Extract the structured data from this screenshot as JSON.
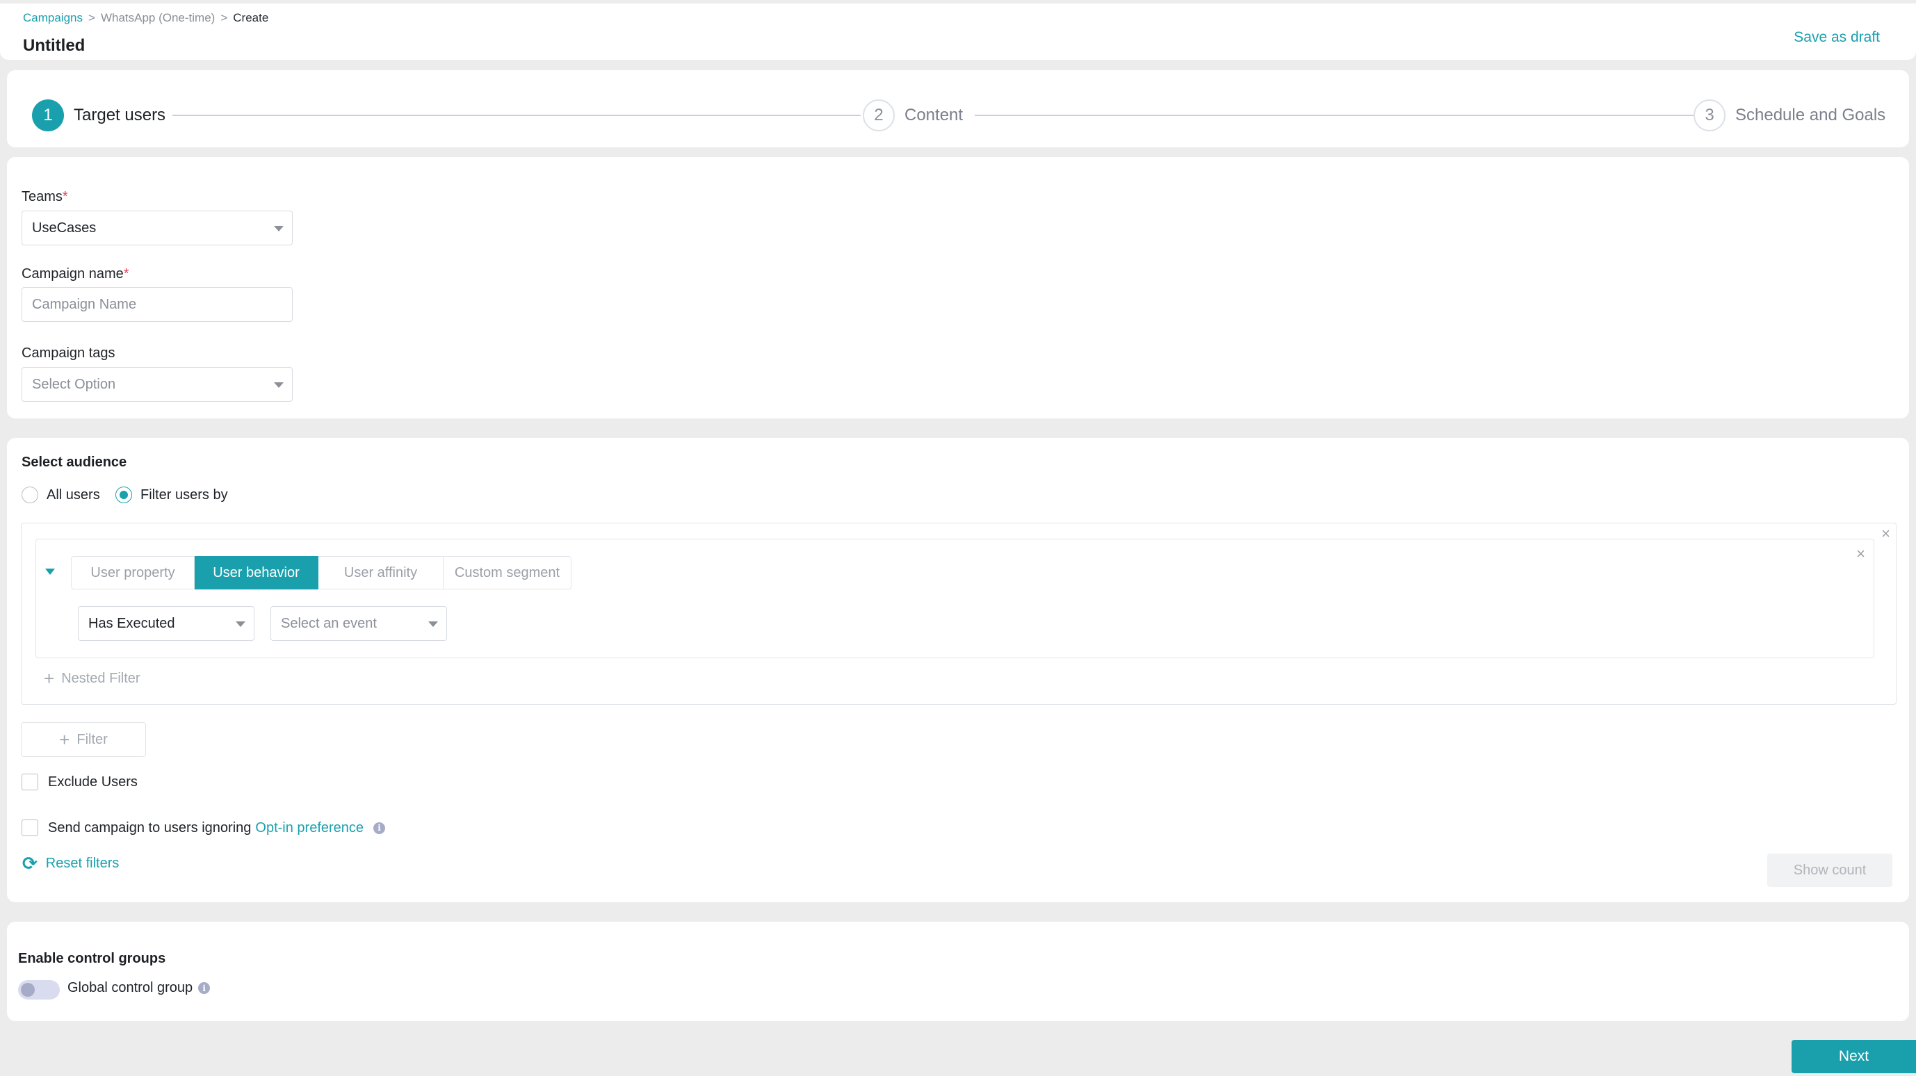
{
  "header": {
    "breadcrumb": {
      "root": "Campaigns",
      "middle": "WhatsApp (One-time)",
      "current": "Create",
      "separator": ">"
    },
    "title": "Untitled",
    "save_draft_label": "Save as draft"
  },
  "stepper": {
    "steps": [
      {
        "number": "1",
        "label": "Target users",
        "state": "active"
      },
      {
        "number": "2",
        "label": "Content",
        "state": "inactive"
      },
      {
        "number": "3",
        "label": "Schedule and Goals",
        "state": "inactive"
      }
    ]
  },
  "form": {
    "teams": {
      "label": "Teams",
      "required_mark": "*",
      "value": "UseCases"
    },
    "campaign_name": {
      "label": "Campaign name",
      "required_mark": "*",
      "value": "",
      "placeholder": "Campaign Name"
    },
    "campaign_tags": {
      "label": "Campaign tags",
      "placeholder": "Select Option"
    }
  },
  "audience": {
    "title": "Select audience",
    "options": [
      {
        "label": "All users",
        "checked": false
      },
      {
        "label": "Filter users by",
        "checked": true
      }
    ],
    "filter": {
      "tabs": [
        "User property",
        "User behavior",
        "User affinity",
        "Custom segment"
      ],
      "active_tab": "User behavior",
      "condition": "Has Executed",
      "event_placeholder": "Select an event",
      "nested_filter_label": "Nested Filter",
      "close_glyph": "×"
    },
    "add_filter_label": "Filter",
    "exclude_users_label": "Exclude Users",
    "opt_in": {
      "prefix": "Send campaign to users ignoring",
      "link": "Opt-in preference"
    },
    "reset_filters_label": "Reset filters",
    "show_count_label": "Show count"
  },
  "control_groups": {
    "title": "Enable control groups",
    "global_label": "Global control group",
    "global_enabled": false
  },
  "footer": {
    "next_label": "Next"
  },
  "icons": {
    "plus": "+",
    "info": "i",
    "reset": "⟳"
  },
  "colors": {
    "accent": "#1aa0ad",
    "background": "#ececec",
    "card": "#ffffff"
  }
}
